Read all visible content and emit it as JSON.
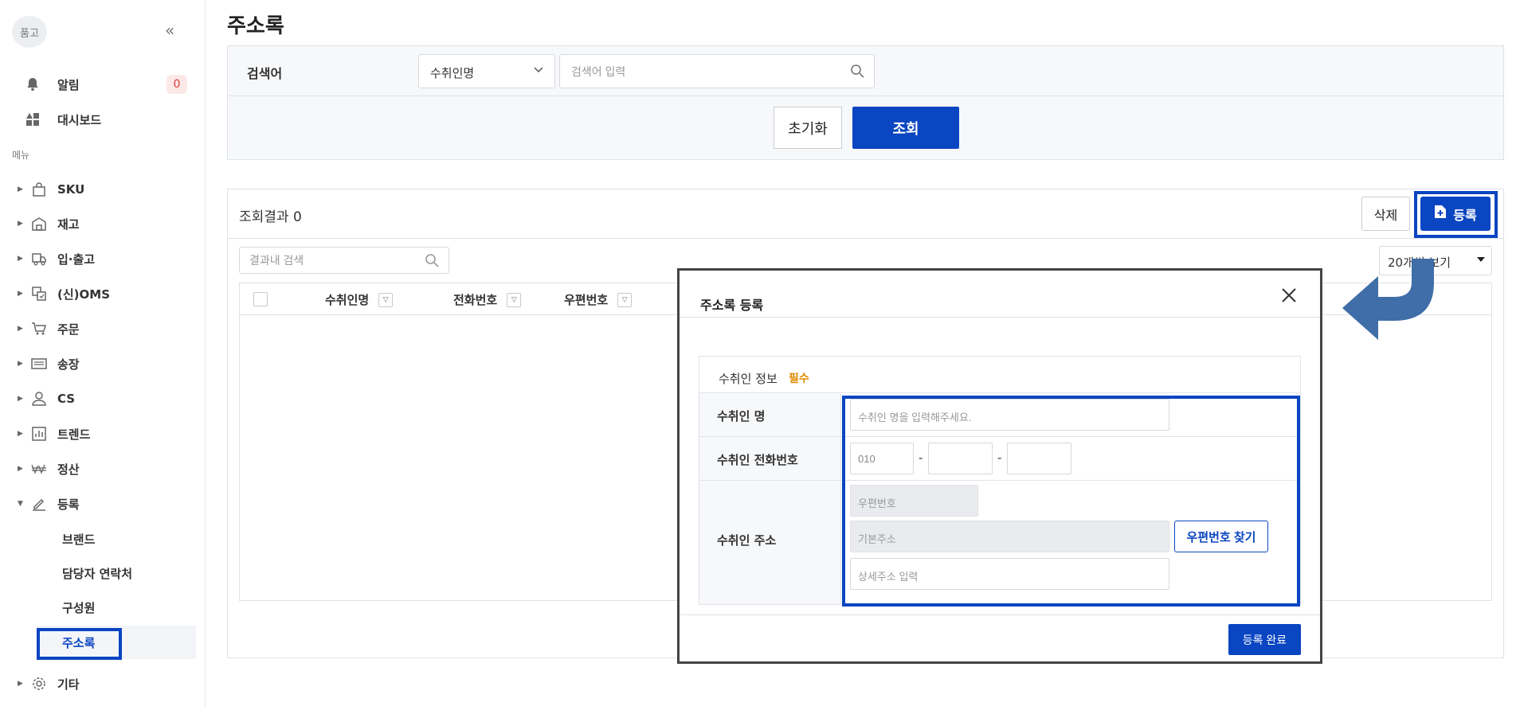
{
  "sidebar": {
    "avatar": "품고",
    "collapse_icon": "double-chevron-left-icon",
    "top_items": [
      {
        "label": "알림",
        "icon": "bell-icon",
        "badge": "0"
      },
      {
        "label": "대시보드",
        "icon": "dashboard-icon"
      }
    ],
    "menu_caption": "메뉴",
    "menu": [
      {
        "label": "SKU",
        "icon": "bag-icon"
      },
      {
        "label": "재고",
        "icon": "warehouse-icon"
      },
      {
        "label": "입·출고",
        "icon": "truck-icon"
      },
      {
        "label": "(신)OMS",
        "icon": "oms-icon"
      },
      {
        "label": "주문",
        "icon": "cart-icon"
      },
      {
        "label": "송장",
        "icon": "invoice-icon"
      },
      {
        "label": "CS",
        "icon": "user-icon"
      },
      {
        "label": "트렌드",
        "icon": "chart-icon"
      },
      {
        "label": "정산",
        "icon": "won-icon"
      },
      {
        "label": "등록",
        "icon": "pencil-icon",
        "expanded": true
      },
      {
        "label": "기타",
        "icon": "gear-icon"
      }
    ],
    "submenu": [
      "브랜드",
      "담당자 연락처",
      "구성원",
      "주소록"
    ],
    "active_submenu": "주소록"
  },
  "page": {
    "title": "주소록"
  },
  "search": {
    "label": "검색어",
    "select_value": "수취인명",
    "input_placeholder": "검색어 입력",
    "reset_label": "초기화",
    "query_label": "조회"
  },
  "results": {
    "title": "조회결과 0",
    "delete_label": "삭제",
    "register_label": "등록",
    "search_placeholder": "결과내 검색",
    "page_size": "20개씩 보기",
    "columns": [
      "수취인명",
      "전화번호",
      "우편번호"
    ]
  },
  "modal": {
    "title": "주소록 등록",
    "section_title": "수취인 정보",
    "required_label": "필수",
    "name_label": "수취인 명",
    "name_placeholder": "수취인 명을 입력해주세요.",
    "phone_label": "수취인 전화번호",
    "phone_prefix": "010",
    "phone_dash": "-",
    "address_label": "수취인 주소",
    "zip_placeholder": "우편번호",
    "base_address_placeholder": "기본주소",
    "detail_address_placeholder": "상세주소 입력",
    "find_zip_label": "우편번호 찾기",
    "submit_label": "등록 완료"
  },
  "colors": {
    "accent": "#0a45c2",
    "arrow": "#3f6ea8",
    "required": "#e08a00",
    "badge": "#e53935"
  }
}
